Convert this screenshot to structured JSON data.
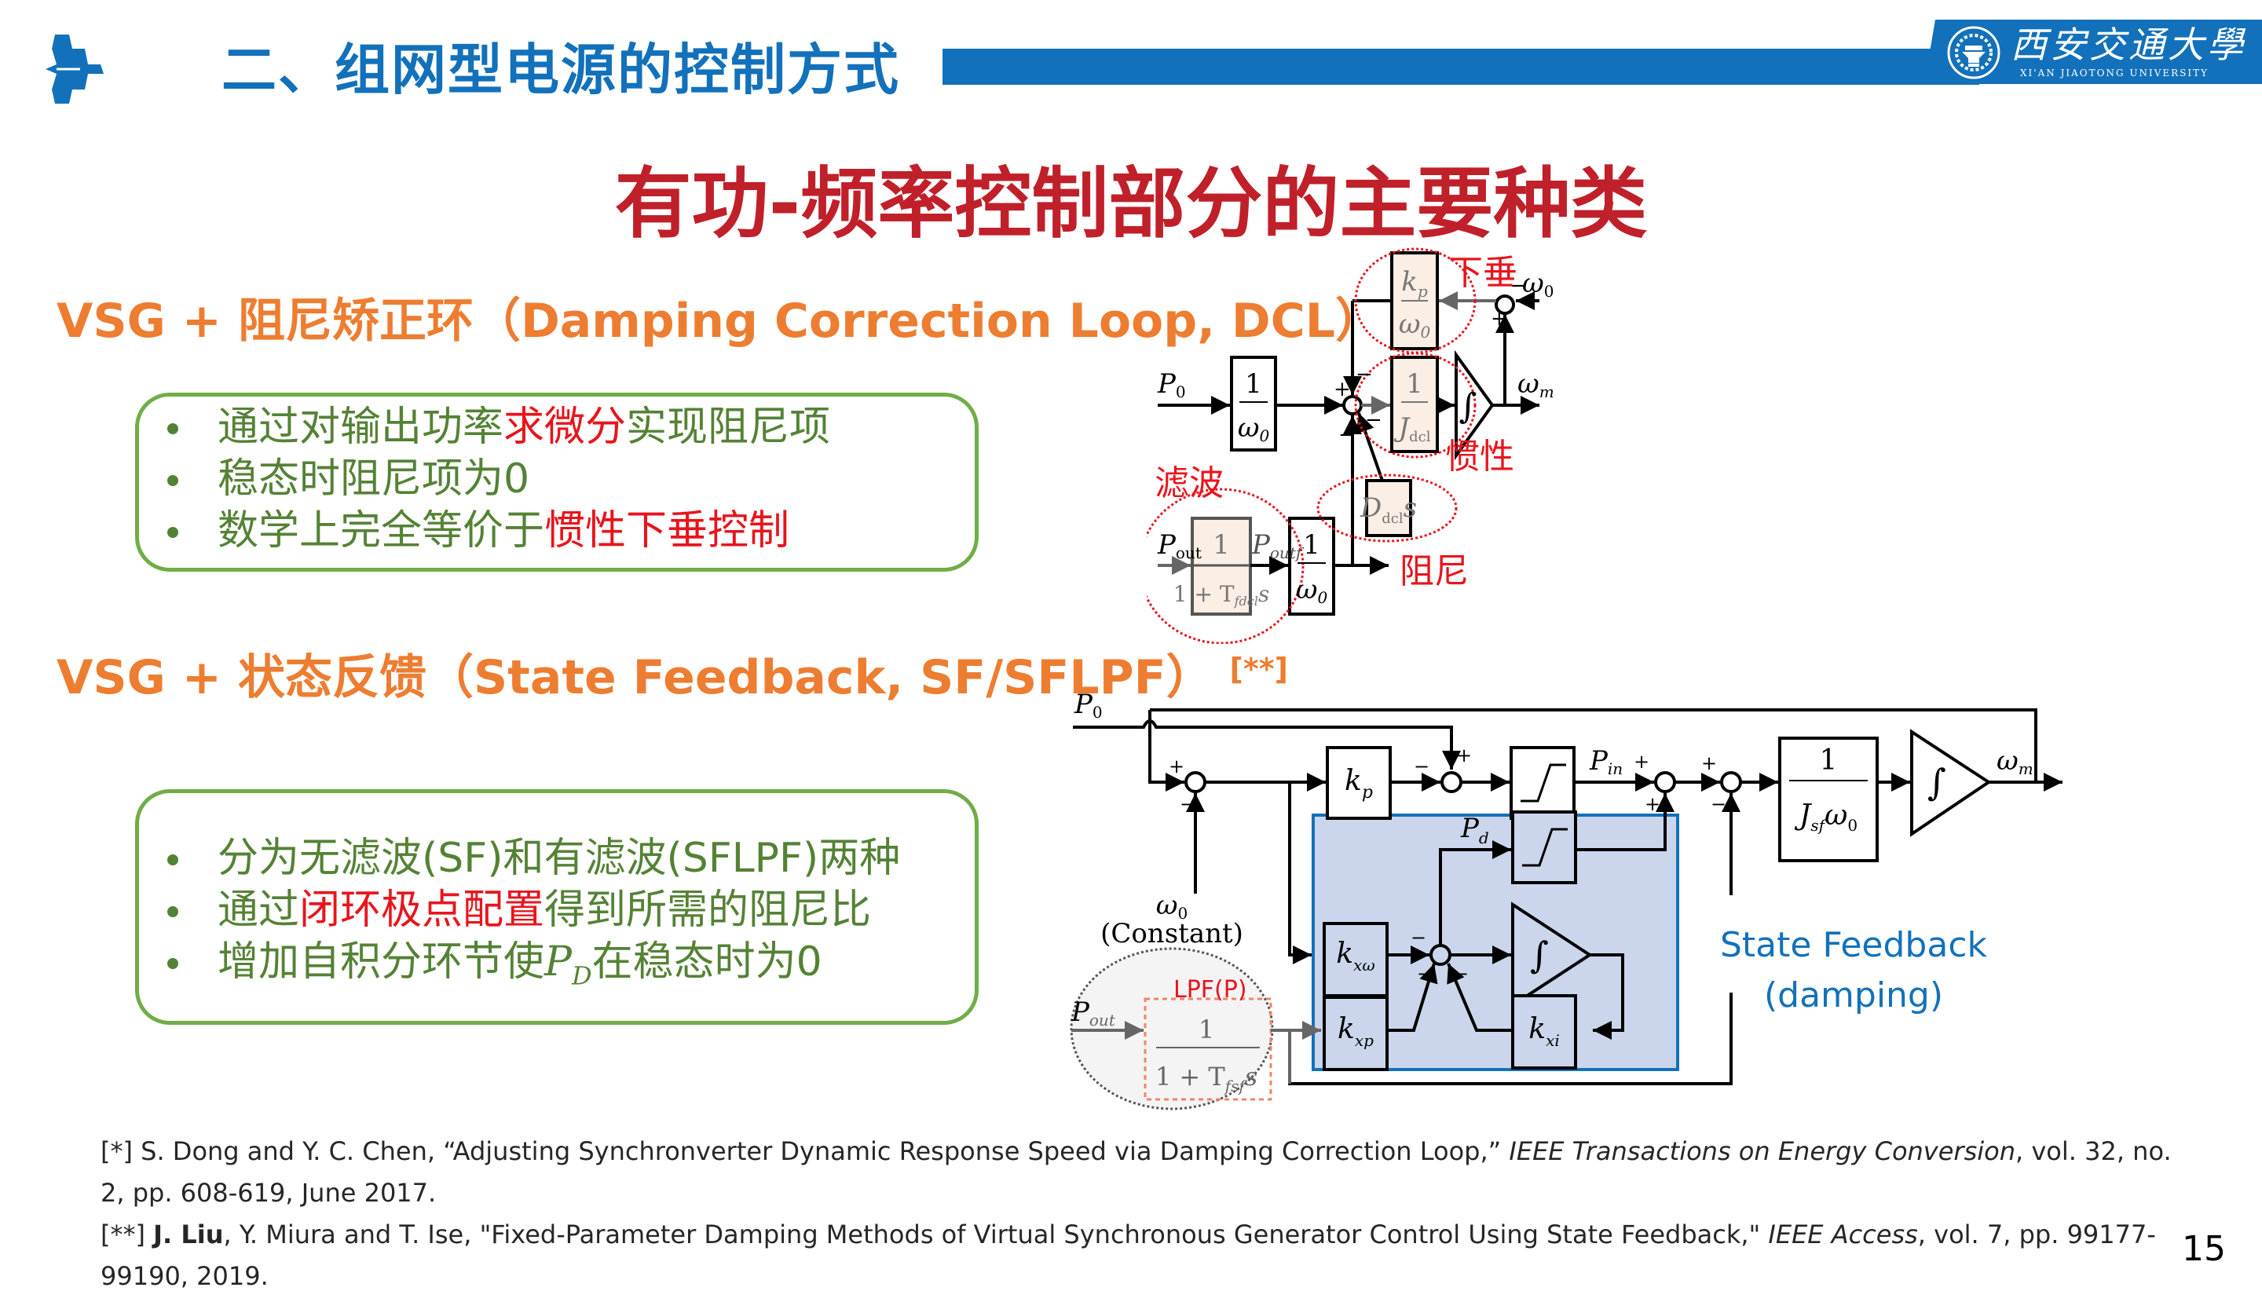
{
  "header": {
    "section_title": "二、组网型电源的控制方式",
    "university_name_cn": "西安交通大學",
    "university_name_en": "XI'AN JIAOTONG UNIVERSITY",
    "brand_color": "#1271ba"
  },
  "main_title": "有功-频率控制部分的主要种类",
  "section1": {
    "heading": "VSG + 阻尼矫正环（Damping Correction Loop, DCL）",
    "ref_mark": "[*]",
    "bullets": [
      {
        "parts": [
          {
            "text": "通过对输出功率",
            "hl": false
          },
          {
            "text": "求微分",
            "hl": true
          },
          {
            "text": "实现阻尼项",
            "hl": false
          }
        ]
      },
      {
        "parts": [
          {
            "text": "稳态时阻尼项为0",
            "hl": false
          }
        ]
      },
      {
        "parts": [
          {
            "text": "数学上完全等价于",
            "hl": false
          },
          {
            "text": "惯性下垂控制",
            "hl": true
          }
        ]
      }
    ]
  },
  "section2": {
    "heading": "VSG + 状态反馈（State Feedback, SF/SFLPF）",
    "ref_mark": "[**]",
    "bullets": [
      {
        "parts": [
          {
            "text": "分为无滤波(SF)和有滤波(SFLPF)两种",
            "hl": false
          }
        ]
      },
      {
        "parts": [
          {
            "text": "通过",
            "hl": false
          },
          {
            "text": "闭环极点配置",
            "hl": true
          },
          {
            "text": "得到所需的阻尼比",
            "hl": false
          }
        ]
      },
      {
        "parts": [
          {
            "text": "增加自积分环节使",
            "hl": false
          },
          {
            "text": "P_D",
            "math": true
          },
          {
            "text": "在稳态时为0",
            "hl": false
          }
        ]
      }
    ]
  },
  "diagram_dcl": {
    "inputs": {
      "p0": "P",
      "p0_sub": "0",
      "pout": "P",
      "pout_sub": "out",
      "poutf": "P",
      "poutf_sub": "outf",
      "omega0": "ω",
      "omega0_sub": "0"
    },
    "output": {
      "label": "ω",
      "sub": "m"
    },
    "blocks": {
      "gain_p0": {
        "num": "1",
        "den": "ω",
        "den_sub": "0"
      },
      "droop": {
        "num": "k",
        "num_sub": "p",
        "den": "ω",
        "den_sub": "0"
      },
      "inertia": {
        "num": "1",
        "den": "J",
        "den_sub": "dcl"
      },
      "damping": {
        "main": "D",
        "sub": "dcl",
        "tail": "s"
      },
      "filter": {
        "num": "1",
        "den": "1 + T",
        "den_sub": "fdcl",
        "den_tail": "s"
      },
      "gain_pout": {
        "num": "1",
        "den": "ω",
        "den_sub": "0"
      },
      "integrator": "∫"
    },
    "signs": {
      "sum_main_left": "+",
      "sum_main_top": "−",
      "sum_main_bottom": "−",
      "sum_main_diag": "−",
      "sum_w_right": "−",
      "sum_w_bottom": "+"
    },
    "annotations": {
      "droop": "下垂",
      "inertia": "惯性",
      "filter": "滤波",
      "damping": "阻尼"
    }
  },
  "diagram_sf": {
    "inputs": {
      "p0": "P",
      "p0_sub": "0",
      "pout": "P",
      "pout_sub": "out",
      "omega0": "ω",
      "omega0_sub": "0",
      "omega0_note": "(Constant)",
      "pin": "P",
      "pin_sub": "in",
      "pd": "P",
      "pd_sub": "d"
    },
    "output": {
      "label": "ω",
      "sub": "m"
    },
    "blocks": {
      "kp": {
        "main": "k",
        "sub": "p"
      },
      "kxw": {
        "main": "k",
        "sub": "xω"
      },
      "kxp": {
        "main": "k",
        "sub": "xp"
      },
      "kxi": {
        "main": "k",
        "sub": "xi"
      },
      "inertia": {
        "num": "1",
        "den": "J",
        "den_sub": "sf",
        "den_tail": "ω",
        "den_tail_sub": "0"
      },
      "lpf": {
        "num": "1",
        "den": "1 + T",
        "den_sub": "fsf",
        "den_tail": "s"
      },
      "integrator": "∫"
    },
    "signs": {
      "s1_left": "+",
      "s1_bottom": "−",
      "s2_left": "−",
      "s2_top": "+",
      "s3_left": "+",
      "s3_bottom": "+",
      "s4_left": "+",
      "s4_bottom": "−",
      "s5_left": "−",
      "s5_bl": "−",
      "s5_br": "−"
    },
    "lpf_label": "LPF(P)",
    "feedback_label_line1": "State Feedback",
    "feedback_label_line2": "(damping)"
  },
  "references": [
    {
      "mark": "[*]",
      "authors_bold": "",
      "authors": "S. Dong and Y. C. Chen, ",
      "title": "“Adjusting Synchronverter Dynamic Response Speed via Damping Correction Loop,” ",
      "venue": "IEEE Transactions on Energy Conversion",
      "details": ", vol. 32, no. 2, pp. 608-619, June 2017."
    },
    {
      "mark": "[**]",
      "authors_bold": "J. Liu",
      "authors": ", Y. Miura and T. Ise, ",
      "title": "\"Fixed-Parameter Damping Methods of Virtual Synchronous Generator Control Using State Feedback,\" ",
      "venue": "IEEE Access",
      "details": ", vol. 7, pp. 99177-99190, 2019."
    }
  ],
  "page_number": "15"
}
